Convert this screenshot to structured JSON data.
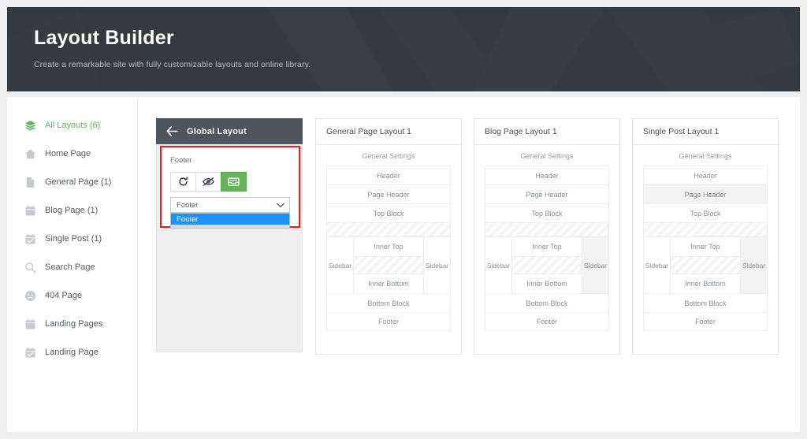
{
  "hero": {
    "title": "Layout Builder",
    "subtitle": "Create a remarkable site with fully customizable layouts and online library."
  },
  "sidebar": {
    "items": [
      {
        "label": "All Layouts (6)",
        "icon": "layers-icon",
        "active": true
      },
      {
        "label": "Home Page",
        "icon": "home-icon",
        "active": false
      },
      {
        "label": "General Page (1)",
        "icon": "file-icon",
        "active": false
      },
      {
        "label": "Blog Page (1)",
        "icon": "calendar-icon",
        "active": false
      },
      {
        "label": "Single Post (1)",
        "icon": "calendar-check-icon",
        "active": false
      },
      {
        "label": "Search Page",
        "icon": "search-icon",
        "active": false
      },
      {
        "label": "404 Page",
        "icon": "sad-face-icon",
        "active": false
      },
      {
        "label": "Landing Pages",
        "icon": "calendar-icon",
        "active": false
      },
      {
        "label": "Landing Page",
        "icon": "calendar-check-icon",
        "active": false
      }
    ]
  },
  "global_panel": {
    "title": "Global Layout",
    "back_icon": "arrow-left-icon",
    "section_label": "Footer",
    "buttons": [
      {
        "name": "refresh-button",
        "icon": "refresh-icon",
        "active": false
      },
      {
        "name": "hide-button",
        "icon": "eye-slash-icon",
        "active": false
      },
      {
        "name": "archive-button",
        "icon": "inbox-icon",
        "active": true
      }
    ],
    "select": {
      "value": "Footer",
      "chevron_icon": "chevron-down-icon",
      "options": [
        "Footer"
      ]
    }
  },
  "colors": {
    "hero_bg": "#353a40",
    "panel_head_bg": "#4f555c",
    "highlight_red": "#ee1c1c",
    "accent_green": "#66b45a",
    "option_blue": "#1e90ff",
    "sidebar_active": "#62b562"
  },
  "layout_cards": [
    {
      "title": "General Page Layout 1",
      "general_settings": "General Settings",
      "header": "Header",
      "page_header": "Page Header",
      "page_header_shaded": false,
      "top_block": "Top Block",
      "sidebar_left": "Sidebar",
      "sidebar_right": "Sidebar",
      "sidebar_right_shaded": false,
      "inner_top": "Inner Top",
      "inner_bottom": "Inner Bottom",
      "bottom_block": "Bottom Block",
      "footer": "Footer"
    },
    {
      "title": "Blog Page Layout 1",
      "general_settings": "General Settings",
      "header": "Header",
      "page_header": "Page Header",
      "page_header_shaded": false,
      "top_block": "Top Block",
      "sidebar_left": "Sidebar",
      "sidebar_right": "Sidebar",
      "sidebar_right_shaded": true,
      "inner_top": "Inner Top",
      "inner_bottom": "Inner Bottom",
      "bottom_block": "Bottom Block",
      "footer": "Footer"
    },
    {
      "title": "Single Post Layout 1",
      "general_settings": "General Settings",
      "header": "Header",
      "page_header": "Page Header",
      "page_header_shaded": true,
      "top_block": "Top Block",
      "sidebar_left": "Sidebar",
      "sidebar_right": "Sidebar",
      "sidebar_right_shaded": true,
      "inner_top": "Inner Top",
      "inner_bottom": "Inner Bottom",
      "bottom_block": "Bottom Block",
      "footer": "Footer"
    }
  ]
}
